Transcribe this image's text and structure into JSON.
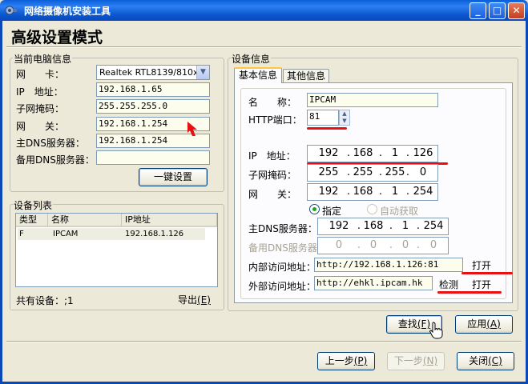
{
  "window": {
    "title": "网络摄像机安装工具",
    "minimize": "_",
    "maximize": "□",
    "close": "✕"
  },
  "page_title": "高级设置模式",
  "pc_info": {
    "legend": "当前电脑信息",
    "nic_label": "网　　卡：",
    "nic_value": "Realtek RTL8139/810x",
    "ip_label": "IP　地址：",
    "ip_value": "192.168.1.65",
    "mask_label": "子网掩码：",
    "mask_value": "255.255.255.0",
    "gateway_label": "网　　关：",
    "gateway_value": "192.168.1.254",
    "dns1_label": "主DNS服务器：",
    "dns1_value": "192.168.1.254",
    "dns2_label": "备用DNS服务器：",
    "dns2_value": "",
    "onekey_button": "一键设置"
  },
  "device_list": {
    "legend": "设备列表",
    "columns": [
      "类型",
      "名称",
      "IP地址"
    ],
    "rows": [
      {
        "type": "F",
        "name": "IPCAM",
        "ip": "192.168.1.126"
      }
    ],
    "total_label": "共有设备：;1",
    "export_button": "导出",
    "export_key": "(E)"
  },
  "device_info": {
    "legend": "设备信息",
    "tabs": [
      "基本信息",
      "其他信息"
    ],
    "name_label": "名　　称：",
    "name_value": "IPCAM",
    "http_label": "HTTP端口：",
    "http_value": "81",
    "ip_label": "IP　地址：",
    "ip": [
      "192",
      "168",
      "1",
      "126"
    ],
    "mask_label": "子网掩码：",
    "mask": [
      "255",
      "255",
      "255",
      "0"
    ],
    "gateway_label": "网　　关：",
    "gateway": [
      "192",
      "168",
      "1",
      "254"
    ],
    "radio_fixed": "指定",
    "radio_auto": "自动获取",
    "dns1_label": "主DNS服务器：",
    "dns1": [
      "192",
      "168",
      "1",
      "254"
    ],
    "dns2_label": "备用DNS服务器：",
    "dns2": [
      "0",
      "0",
      "0",
      "0"
    ],
    "internal_label": "内部访问地址：",
    "internal_value": "http://192.168.1.126:81",
    "open_label": "打开",
    "external_label": "外部访问地址：",
    "external_value": "http://ehkl.ipcam.hk",
    "check_label": "检测"
  },
  "buttons": {
    "search": "查找",
    "search_key": "(F)",
    "apply": "应用",
    "apply_key": "(A)",
    "prev": "上一步",
    "prev_key": "(P)",
    "next": "下一步",
    "next_key": "(N)",
    "close": "关闭",
    "close_key": "(C)"
  },
  "colors": {
    "title_bar": "#0a5fd8",
    "window_bg": "#ece9d8",
    "annotation_red": "#e81010"
  }
}
